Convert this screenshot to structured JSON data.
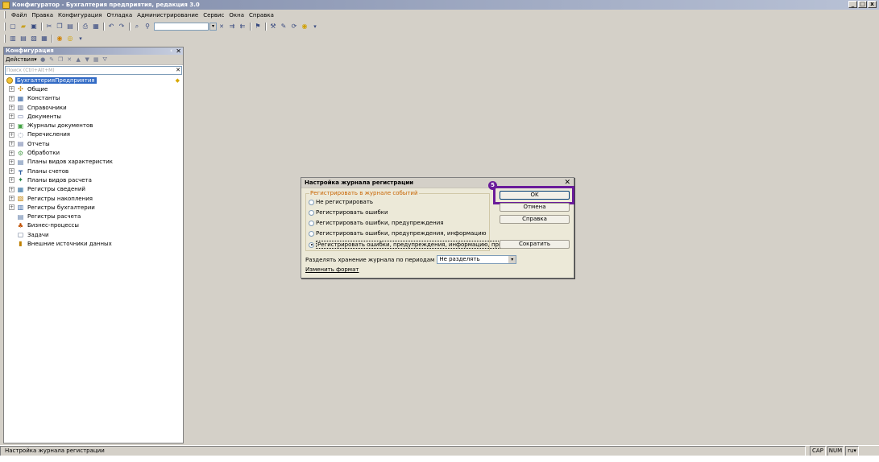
{
  "window": {
    "title": "Конфигуратор - Бухгалтерия предприятия, редакция 3.0",
    "controls": [
      "_",
      "□",
      "x"
    ]
  },
  "menu": [
    "Файл",
    "Правка",
    "Конфигурация",
    "Отладка",
    "Администрирование",
    "Сервис",
    "Окна",
    "Справка"
  ],
  "toolbar1": {
    "icons": [
      "new-icon",
      "open-icon",
      "save-icon",
      "cut-icon",
      "copy-icon",
      "paste-icon",
      "print-icon",
      "preview-icon",
      "undo-icon",
      "redo-icon",
      "find-icon",
      "search-icon",
      "find-next-icon",
      "find-prev-icon",
      "bookmark-icon",
      "syntax-icon",
      "wizard-icon",
      "update-icon",
      "help-icon"
    ]
  },
  "toolbar2": {
    "icons": [
      "config-tree-icon",
      "properties-icon",
      "module-icon",
      "db-icon",
      "run-icon",
      "debug-icon"
    ]
  },
  "config_panel": {
    "title": "Конфигурация",
    "pin": "‹",
    "close": "✕",
    "actions_label": "Действия",
    "search_placeholder": "Поиск (Ctrl+Alt+M)",
    "search_clear": "✕",
    "root": "БухгалтерияПредприятия",
    "items": [
      {
        "label": "Общие",
        "expandable": true,
        "icon": "common-icon"
      },
      {
        "label": "Константы",
        "expandable": true,
        "icon": "constants-icon"
      },
      {
        "label": "Справочники",
        "expandable": true,
        "icon": "catalogs-icon"
      },
      {
        "label": "Документы",
        "expandable": true,
        "icon": "documents-icon"
      },
      {
        "label": "Журналы документов",
        "expandable": true,
        "icon": "journals-icon"
      },
      {
        "label": "Перечисления",
        "expandable": true,
        "icon": "enums-icon"
      },
      {
        "label": "Отчеты",
        "expandable": true,
        "icon": "reports-icon"
      },
      {
        "label": "Обработки",
        "expandable": true,
        "icon": "dataprocessors-icon"
      },
      {
        "label": "Планы видов характеристик",
        "expandable": true,
        "icon": "chart-of-characteristics-icon"
      },
      {
        "label": "Планы счетов",
        "expandable": true,
        "icon": "chart-of-accounts-icon"
      },
      {
        "label": "Планы видов расчета",
        "expandable": true,
        "icon": "chart-of-calc-icon"
      },
      {
        "label": "Регистры сведений",
        "expandable": true,
        "icon": "info-registers-icon"
      },
      {
        "label": "Регистры накопления",
        "expandable": true,
        "icon": "accum-registers-icon"
      },
      {
        "label": "Регистры бухгалтерии",
        "expandable": true,
        "icon": "accounting-registers-icon"
      },
      {
        "label": "Регистры расчета",
        "expandable": false,
        "icon": "calc-registers-icon"
      },
      {
        "label": "Бизнес-процессы",
        "expandable": false,
        "icon": "business-process-icon"
      },
      {
        "label": "Задачи",
        "expandable": false,
        "icon": "tasks-icon"
      },
      {
        "label": "Внешние источники данных",
        "expandable": false,
        "icon": "external-sources-icon"
      }
    ]
  },
  "dialog": {
    "title": "Настройка журнала регистрации",
    "close": "✕",
    "group_label": "Регистрировать в журнале событий",
    "options": [
      "Не регистрировать",
      "Регистрировать ошибки",
      "Регистрировать ошибки, предупреждения",
      "Регистрировать ошибки, предупреждения, информацию",
      "Регистрировать ошибки, предупреждения, информацию, примечания"
    ],
    "selected_option": 4,
    "buttons": {
      "ok": "OK",
      "cancel": "Отмена",
      "help": "Справка",
      "shrink": "Сократить"
    },
    "period_label": "Разделять хранение журнала по периодам",
    "period_value": "Не разделять",
    "change_format": "Изменить формат",
    "step_badge": "5",
    "highlight_color": "#6a1b9a"
  },
  "status": {
    "text": "Настройка журнала регистрации",
    "cap": "CAP",
    "num": "NUM",
    "lang": "ru▾"
  }
}
